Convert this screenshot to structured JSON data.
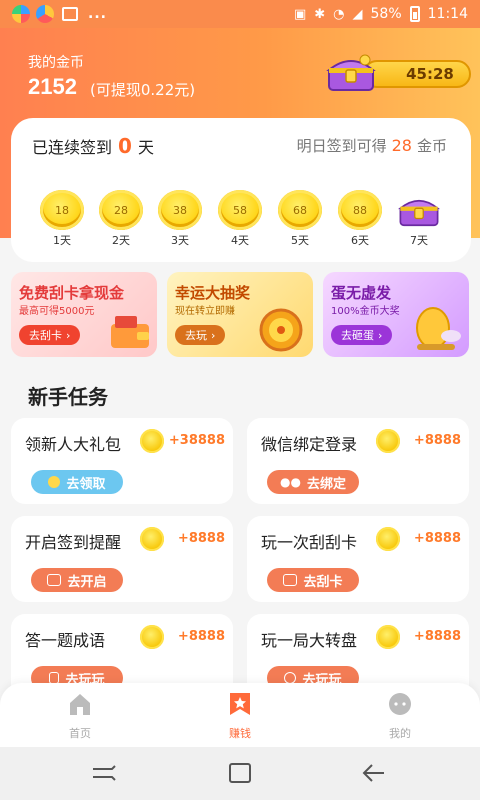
{
  "status_bar": {
    "battery": "58%",
    "time": "11:14",
    "dots": "..."
  },
  "header": {
    "my_coins_label": "我的金币",
    "coin_amount": "2152",
    "coin_cash": "(可提现0.22元)",
    "chest_timer": "45:28"
  },
  "checkin": {
    "prefix": "已连续签到",
    "days": "0",
    "suffix": "天",
    "tomorrow_prefix": "明日签到可得",
    "tomorrow_amount": "28",
    "tomorrow_suffix": "金币",
    "days_list": [
      {
        "value": "18",
        "label": "1天"
      },
      {
        "value": "28",
        "label": "2天"
      },
      {
        "value": "38",
        "label": "3天"
      },
      {
        "value": "58",
        "label": "4天"
      },
      {
        "value": "68",
        "label": "5天"
      },
      {
        "value": "88",
        "label": "6天"
      },
      {
        "value": "",
        "label": "7天"
      }
    ]
  },
  "promos": [
    {
      "title": "免费刮卡拿现金",
      "subtitle": "最高可得5000元",
      "button": "去刮卡"
    },
    {
      "title": "幸运大抽奖",
      "subtitle": "现在转立即赚",
      "button": "去玩"
    },
    {
      "title": "蛋无虚发",
      "subtitle": "100%金币大奖",
      "button": "去砸蛋"
    }
  ],
  "section_title": "新手任务",
  "tasks": [
    {
      "name": "领新人大礼包",
      "reward": "+38888",
      "button": "去领取",
      "icon": "coin-icon"
    },
    {
      "name": "微信绑定登录",
      "reward": "+8888",
      "button": "去绑定",
      "icon": "wechat-icon"
    },
    {
      "name": "开启签到提醒",
      "reward": "+8888",
      "button": "去开启",
      "icon": "calendar-icon"
    },
    {
      "name": "玩一次刮刮卡",
      "reward": "+8888",
      "button": "去刮卡",
      "icon": "scratch-card-icon"
    },
    {
      "name": "答一题成语",
      "reward": "+8888",
      "button": "去玩玩",
      "icon": "book-icon"
    },
    {
      "name": "玩一局大转盘",
      "reward": "+8888",
      "button": "去玩玩",
      "icon": "wheel-icon"
    }
  ],
  "tabs": [
    {
      "label": "首页",
      "icon": "home-icon",
      "active": false
    },
    {
      "label": "赚钱",
      "icon": "star-bookmark-icon",
      "active": true
    },
    {
      "label": "我的",
      "icon": "profile-icon",
      "active": false
    }
  ],
  "colors": {
    "accent": "#ff6a2a",
    "header_start": "#ff8050",
    "header_end": "#ffc35a"
  }
}
